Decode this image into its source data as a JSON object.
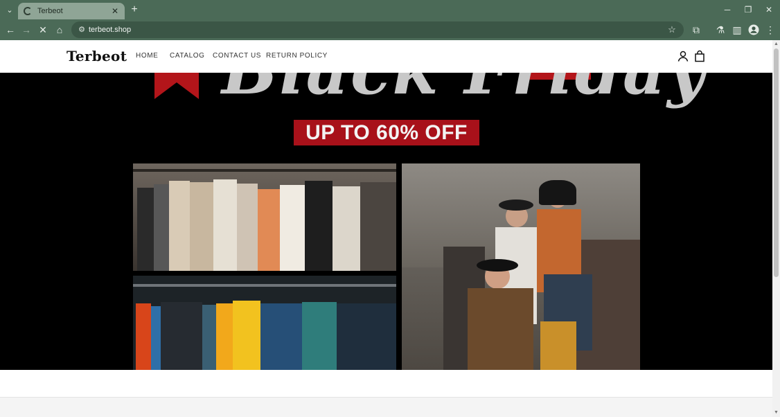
{
  "browser": {
    "tab_title": "Terbeot",
    "url": "terbeot.shop"
  },
  "site": {
    "logo": "Terbeot",
    "nav": [
      "HOME",
      "CATALOG",
      "CONTACT US",
      "RETURN POLICY"
    ]
  },
  "hero": {
    "script_text": "Black Friday",
    "promo": "UP TO 60% OFF"
  },
  "colors": {
    "chrome": "#4b6a57",
    "promo_red": "#a8111a"
  }
}
